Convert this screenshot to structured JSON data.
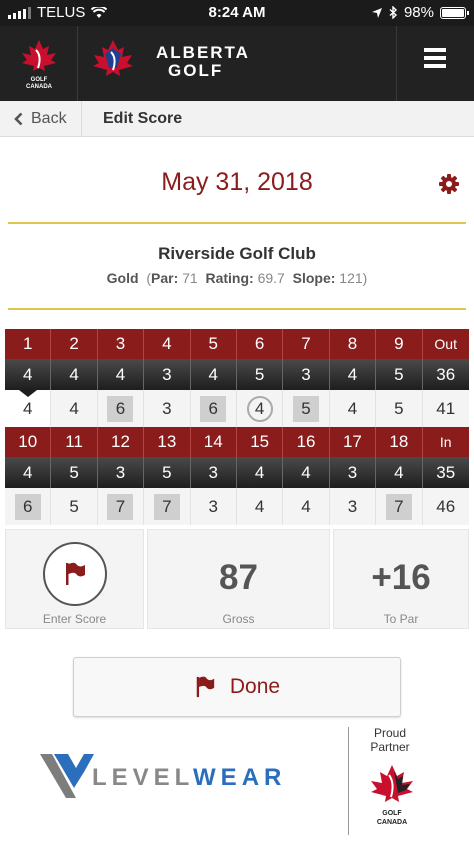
{
  "status_bar": {
    "carrier": "TELUS",
    "time": "8:24 AM",
    "battery": "98%",
    "battery_level": 0.98
  },
  "header": {
    "logo_left_text": "GOLF CANADA",
    "brand_line1": "ALBERTA",
    "brand_line2": "GOLF",
    "menu_icon": "hamburger-menu-icon"
  },
  "nav": {
    "back_label": "Back",
    "title": "Edit Score"
  },
  "round": {
    "date": "May 31, 2018",
    "club_name": "Riverside Golf Club",
    "tee": "Gold",
    "par_label": "Par:",
    "par": "71",
    "rating_label": "Rating:",
    "rating": "69.7",
    "slope_label": "Slope:",
    "slope": "121"
  },
  "scorecard": {
    "front": {
      "holes": [
        "1",
        "2",
        "3",
        "4",
        "5",
        "6",
        "7",
        "8",
        "9",
        "Out"
      ],
      "pars": [
        "4",
        "4",
        "4",
        "3",
        "4",
        "5",
        "3",
        "4",
        "5",
        "36"
      ],
      "scores": [
        "4",
        "4",
        "6",
        "3",
        "6",
        "4",
        "5",
        "4",
        "5",
        "41"
      ]
    },
    "back": {
      "holes": [
        "10",
        "11",
        "12",
        "13",
        "14",
        "15",
        "16",
        "17",
        "18",
        "In"
      ],
      "pars": [
        "4",
        "5",
        "3",
        "5",
        "3",
        "4",
        "4",
        "3",
        "4",
        "35"
      ],
      "scores": [
        "6",
        "5",
        "7",
        "7",
        "3",
        "4",
        "4",
        "3",
        "7",
        "46"
      ]
    }
  },
  "stats": {
    "enter_score_label": "Enter Score",
    "gross": "87",
    "gross_label": "Gross",
    "to_par": "+16",
    "to_par_label": "To Par"
  },
  "done_label": "Done",
  "footer": {
    "sponsor_part1": "LEVEL",
    "sponsor_part2": "WEAR",
    "proud_line1": "Proud",
    "proud_line2": "Partner",
    "partner_logo_text": "GOLF CANADA"
  },
  "colors": {
    "accent_red": "#8b1c1c",
    "gold_rule": "#e0c64a",
    "header_dark": "#222222",
    "levelwear_blue": "#2a6ebc"
  }
}
